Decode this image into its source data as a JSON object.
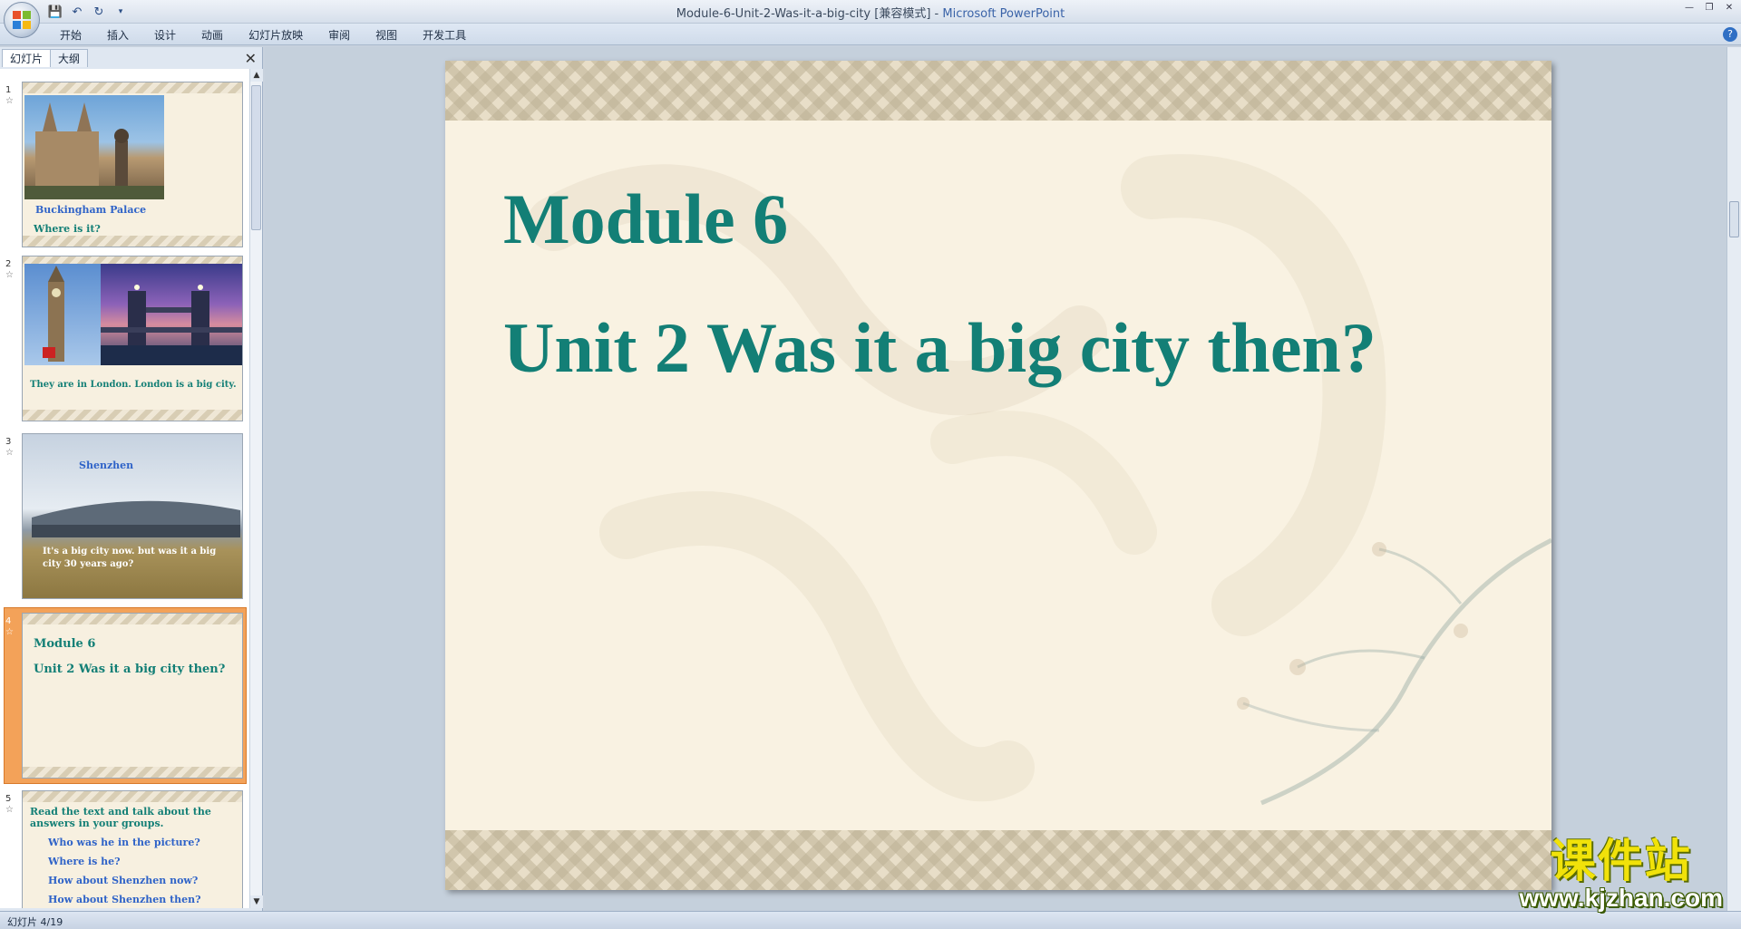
{
  "window": {
    "title": "Module-6-Unit-2-Was-it-a-big-city [兼容模式]",
    "title_sep": " - ",
    "app_name": "Microsoft PowerPoint"
  },
  "ribbon": {
    "tabs": [
      "开始",
      "插入",
      "设计",
      "动画",
      "幻灯片放映",
      "审阅",
      "视图",
      "开发工具"
    ]
  },
  "pane": {
    "tabs": [
      "幻灯片",
      "大纲"
    ],
    "active_tab": "幻灯片"
  },
  "thumbnails": [
    {
      "num": "1",
      "lines": [
        "Buckingham Palace",
        "Where is it?"
      ]
    },
    {
      "num": "2",
      "lines": [
        "They are in London. London is a big city."
      ]
    },
    {
      "num": "3",
      "lines": [
        "Shenzhen",
        "It's a big city  now. but was it a big",
        "city 30 years ago?"
      ]
    },
    {
      "num": "4",
      "lines": [
        "Module 6",
        "Unit 2 Was it  a big city then?"
      ]
    },
    {
      "num": "5",
      "lines": [
        "Read the text and talk about the",
        "answers in your groups.",
        "Who was he in the picture?",
        "Where is he?",
        "How about Shenzhen now?",
        "How about Shenzhen then?"
      ]
    }
  ],
  "slide": {
    "title": "Module 6",
    "subtitle": "Unit 2 Was it a big city then?"
  },
  "status": {
    "text": "幻灯片 4/19"
  },
  "watermark": {
    "cn": "课件站",
    "url": "www.kjzhan.com"
  },
  "colors": {
    "slide_text": "#137f76",
    "thumb_blue": "#2f63c8",
    "thumb_teal": "#137f76",
    "selection": "#f3a259"
  }
}
